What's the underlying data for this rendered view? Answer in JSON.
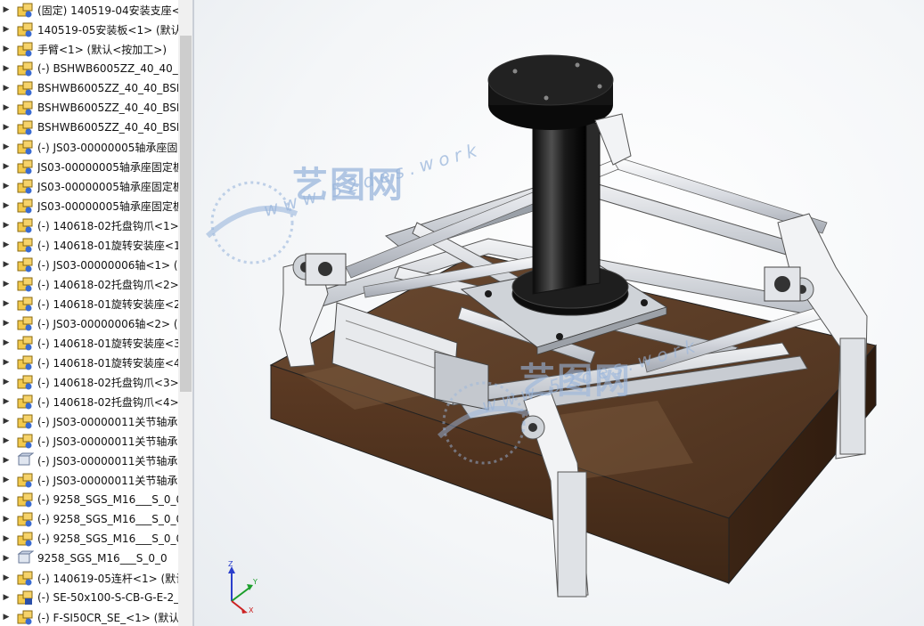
{
  "feature_tree": {
    "items": [
      {
        "label": "(固定) 140519-04安装支座<",
        "icon": "assembly-icon"
      },
      {
        "label": "140519-05安装板<1> (默认",
        "icon": "assembly-icon"
      },
      {
        "label": "手臂<1> (默认<按加工>)",
        "icon": "assembly-icon"
      },
      {
        "label": "(-) BSHWB6005ZZ_40_40_B",
        "icon": "assembly-icon"
      },
      {
        "label": "BSHWB6005ZZ_40_40_BSH",
        "icon": "assembly-icon"
      },
      {
        "label": "BSHWB6005ZZ_40_40_BSH",
        "icon": "assembly-icon"
      },
      {
        "label": "BSHWB6005ZZ_40_40_BSH",
        "icon": "assembly-icon"
      },
      {
        "label": "(-) JS03-00000005轴承座固定",
        "icon": "assembly-icon"
      },
      {
        "label": "JS03-00000005轴承座固定板",
        "icon": "assembly-icon"
      },
      {
        "label": "JS03-00000005轴承座固定板",
        "icon": "assembly-icon"
      },
      {
        "label": "JS03-00000005轴承座固定板",
        "icon": "assembly-icon"
      },
      {
        "label": "(-) 140618-02托盘钩爪<1>",
        "icon": "assembly-icon"
      },
      {
        "label": "(-) 140618-01旋转安装座<1",
        "icon": "assembly-icon"
      },
      {
        "label": "(-) JS03-00000006轴<1> (默",
        "icon": "assembly-icon"
      },
      {
        "label": "(-) 140618-02托盘钩爪<2>",
        "icon": "assembly-icon"
      },
      {
        "label": "(-) 140618-01旋转安装座<2",
        "icon": "assembly-icon"
      },
      {
        "label": "(-) JS03-00000006轴<2> (默",
        "icon": "assembly-icon"
      },
      {
        "label": "(-) 140618-01旋转安装座<3",
        "icon": "assembly-icon"
      },
      {
        "label": "(-) 140618-01旋转安装座<4",
        "icon": "assembly-icon"
      },
      {
        "label": "(-) 140618-02托盘钩爪<3>",
        "icon": "assembly-icon"
      },
      {
        "label": "(-) 140618-02托盘钩爪<4>",
        "icon": "assembly-icon"
      },
      {
        "label": "(-) JS03-00000011关节轴承",
        "icon": "assembly-icon"
      },
      {
        "label": "(-) JS03-00000011关节轴承",
        "icon": "assembly-icon"
      },
      {
        "label": "(-) JS03-00000011关节轴承",
        "icon": "part-icon"
      },
      {
        "label": "(-) JS03-00000011关节轴承",
        "icon": "assembly-icon"
      },
      {
        "label": "(-) 9258_SGS_M16___S_0_0",
        "icon": "assembly-icon"
      },
      {
        "label": "(-) 9258_SGS_M16___S_0_0",
        "icon": "assembly-icon"
      },
      {
        "label": "(-) 9258_SGS_M16___S_0_0",
        "icon": "assembly-icon"
      },
      {
        "label": "9258_SGS_M16___S_0_0",
        "icon": "part-icon"
      },
      {
        "label": "(-) 140619-05连杆<1> (默认",
        "icon": "assembly-icon"
      },
      {
        "label": "(-) SE-50x100-S-CB-G-E-2_",
        "icon": "subassembly-icon"
      },
      {
        "label": "(-) F-SI50CR_SE_<1> (默认)",
        "icon": "assembly-icon"
      }
    ]
  },
  "watermark": {
    "brand": "艺图网",
    "url": "www.52des.work"
  },
  "triad": {
    "x": "X",
    "y": "Y",
    "z": "Z"
  },
  "colors": {
    "tree_bg": "#ffffff",
    "viewport_bg": "#f4f6f8",
    "wood": "#5a3a24",
    "aluminum": "#d9dde3",
    "dark_part": "#1c1c1c",
    "watermark": "#9ab6dc"
  }
}
